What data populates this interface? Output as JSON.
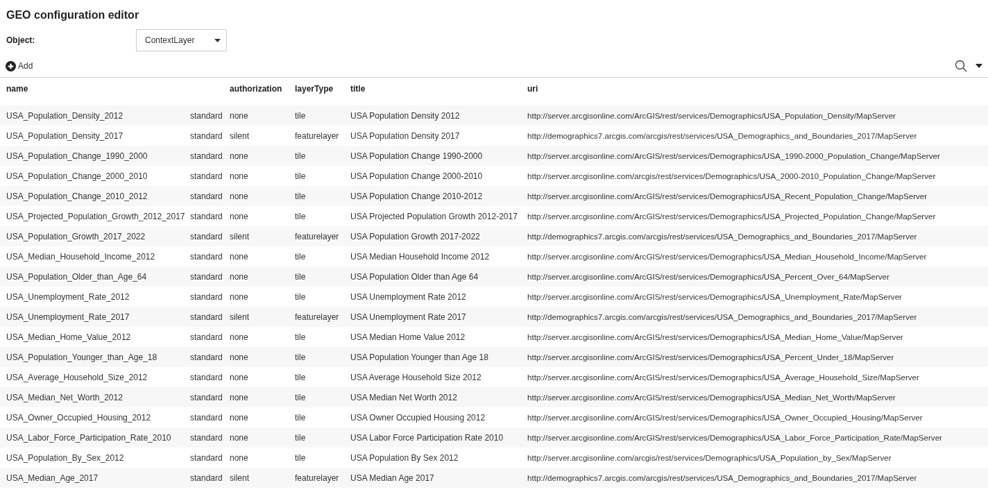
{
  "title": "GEO configuration editor",
  "object_field": {
    "label": "Object:",
    "value": "ContextLayer"
  },
  "toolbar": {
    "add_label": "Add"
  },
  "table": {
    "columns": [
      "name",
      "",
      "authorization",
      "layerType",
      "title",
      "uri"
    ],
    "rows": [
      {
        "name": "USA_Population_Density_2012",
        "column_2": "standard",
        "authorization": "none",
        "layerType": "tile",
        "title": "USA Population Density 2012",
        "uri": "http://server.arcgisonline.com/ArcGIS/rest/services/Demographics/USA_Population_Density/MapServer"
      },
      {
        "name": "USA_Population_Density_2017",
        "column_2": "standard",
        "authorization": "silent",
        "layerType": "featurelayer",
        "title": "USA Population Density 2017",
        "uri": "http://demographics7.arcgis.com/arcgis/rest/services/USA_Demographics_and_Boundaries_2017/MapServer"
      },
      {
        "name": "USA_Population_Change_1990_2000",
        "column_2": "standard",
        "authorization": "none",
        "layerType": "tile",
        "title": "USA Population Change 1990-2000",
        "uri": "http://server.arcgisonline.com/ArcGIS/rest/services/Demographics/USA_1990-2000_Population_Change/MapServer"
      },
      {
        "name": "USA_Population_Change_2000_2010",
        "column_2": "standard",
        "authorization": "none",
        "layerType": "tile",
        "title": "USA Population Change 2000-2010",
        "uri": "http://server.arcgisonline.com/arcgis/rest/services/Demographics/USA_2000-2010_Population_Change/MapServer"
      },
      {
        "name": "USA_Population_Change_2010_2012",
        "column_2": "standard",
        "authorization": "none",
        "layerType": "tile",
        "title": "USA Population Change 2010-2012",
        "uri": "http://server.arcgisonline.com/ArcGIS/rest/services/Demographics/USA_Recent_Population_Change/MapServer"
      },
      {
        "name": "USA_Projected_Population_Growth_2012_2017",
        "column_2": "standard",
        "authorization": "none",
        "layerType": "tile",
        "title": "USA Projected Population Growth 2012-2017",
        "uri": "http://server.arcgisonline.com/ArcGIS/rest/services/Demographics/USA_Projected_Population_Change/MapServer"
      },
      {
        "name": "USA_Population_Growth_2017_2022",
        "column_2": "standard",
        "authorization": "silent",
        "layerType": "featurelayer",
        "title": "USA Population Growth 2017-2022",
        "uri": "http://demographics7.arcgis.com/arcgis/rest/services/USA_Demographics_and_Boundaries_2017/MapServer"
      },
      {
        "name": "USA_Median_Household_Income_2012",
        "column_2": "standard",
        "authorization": "none",
        "layerType": "tile",
        "title": "USA Median Household Income 2012",
        "uri": "http://server.arcgisonline.com/ArcGIS/rest/services/Demographics/USA_Median_Household_Income/MapServer"
      },
      {
        "name": "USA_Population_Older_than_Age_64",
        "column_2": "standard",
        "authorization": "none",
        "layerType": "tile",
        "title": "USA Population Older than Age 64",
        "uri": "http://server.arcgisonline.com/ArcGIS/rest/services/Demographics/USA_Percent_Over_64/MapServer"
      },
      {
        "name": "USA_Unemployment_Rate_2012",
        "column_2": "standard",
        "authorization": "none",
        "layerType": "tile",
        "title": "USA Unemployment Rate 2012",
        "uri": "http://server.arcgisonline.com/ArcGIS/rest/services/Demographics/USA_Unemployment_Rate/MapServer"
      },
      {
        "name": "USA_Unemployment_Rate_2017",
        "column_2": "standard",
        "authorization": "silent",
        "layerType": "featurelayer",
        "title": "USA Unemployment Rate 2017",
        "uri": "http://demographics7.arcgis.com/arcgis/rest/services/USA_Demographics_and_Boundaries_2017/MapServer"
      },
      {
        "name": "USA_Median_Home_Value_2012",
        "column_2": "standard",
        "authorization": "none",
        "layerType": "tile",
        "title": "USA Median Home Value 2012",
        "uri": "http://server.arcgisonline.com/ArcGIS/rest/services/Demographics/USA_Median_Home_Value/MapServer"
      },
      {
        "name": "USA_Population_Younger_than_Age_18",
        "column_2": "standard",
        "authorization": "none",
        "layerType": "tile",
        "title": "USA Population Younger than Age 18",
        "uri": "http://server.arcgisonline.com/ArcGIS/rest/services/Demographics/USA_Percent_Under_18/MapServer"
      },
      {
        "name": "USA_Average_Household_Size_2012",
        "column_2": "standard",
        "authorization": "none",
        "layerType": "tile",
        "title": "USA Average Household Size 2012",
        "uri": "http://server.arcgisonline.com/ArcGIS/rest/services/Demographics/USA_Average_Household_Size/MapServer"
      },
      {
        "name": "USA_Median_Net_Worth_2012",
        "column_2": "standard",
        "authorization": "none",
        "layerType": "tile",
        "title": "USA Median Net Worth 2012",
        "uri": "http://server.arcgisonline.com/ArcGIS/rest/services/Demographics/USA_Median_Net_Worth/MapServer"
      },
      {
        "name": "USA_Owner_Occupied_Housing_2012",
        "column_2": "standard",
        "authorization": "none",
        "layerType": "tile",
        "title": "USA Owner Occupied Housing 2012",
        "uri": "http://server.arcgisonline.com/ArcGIS/rest/services/Demographics/USA_Owner_Occupied_Housing/MapServer"
      },
      {
        "name": "USA_Labor_Force_Participation_Rate_2010",
        "column_2": "standard",
        "authorization": "none",
        "layerType": "tile",
        "title": "USA Labor Force Participation Rate 2010",
        "uri": "http://server.arcgisonline.com/ArcGIS/rest/services/Demographics/USA_Labor_Force_Participation_Rate/MapServer"
      },
      {
        "name": "USA_Population_By_Sex_2012",
        "column_2": "standard",
        "authorization": "none",
        "layerType": "tile",
        "title": "USA Population By Sex 2012",
        "uri": "http://server.arcgisonline.com/arcgis/rest/services/Demographics/USA_Population_by_Sex/MapServer"
      },
      {
        "name": "USA_Median_Age_2017",
        "column_2": "standard",
        "authorization": "silent",
        "layerType": "featurelayer",
        "title": "USA Median Age 2017",
        "uri": "http://demographics7.arcgis.com/arcgis/rest/services/USA_Demographics_and_Boundaries_2017/MapServer"
      }
    ]
  }
}
